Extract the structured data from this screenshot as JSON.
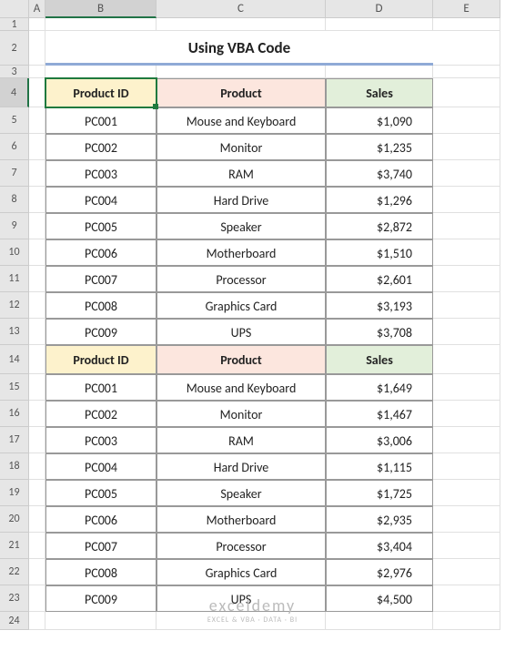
{
  "columns": [
    "",
    "A",
    "B",
    "C",
    "D",
    "E"
  ],
  "title": "Using VBA Code",
  "headers": {
    "b": "Product ID",
    "c": "Product",
    "d": "Sales"
  },
  "rows1": [
    {
      "id": "PC001",
      "product": "Mouse and Keyboard",
      "sales": "$1,090"
    },
    {
      "id": "PC002",
      "product": "Monitor",
      "sales": "$1,235"
    },
    {
      "id": "PC003",
      "product": "RAM",
      "sales": "$3,740"
    },
    {
      "id": "PC004",
      "product": "Hard Drive",
      "sales": "$1,296"
    },
    {
      "id": "PC005",
      "product": "Speaker",
      "sales": "$2,872"
    },
    {
      "id": "PC006",
      "product": "Motherboard",
      "sales": "$1,510"
    },
    {
      "id": "PC007",
      "product": "Processor",
      "sales": "$2,601"
    },
    {
      "id": "PC008",
      "product": "Graphics Card",
      "sales": "$3,193"
    },
    {
      "id": "PC009",
      "product": "UPS",
      "sales": "$3,708"
    }
  ],
  "rows2": [
    {
      "id": "PC001",
      "product": "Mouse and Keyboard",
      "sales": "$1,649"
    },
    {
      "id": "PC002",
      "product": "Monitor",
      "sales": "$1,467"
    },
    {
      "id": "PC003",
      "product": "RAM",
      "sales": "$3,006"
    },
    {
      "id": "PC004",
      "product": "Hard Drive",
      "sales": "$1,115"
    },
    {
      "id": "PC005",
      "product": "Speaker",
      "sales": "$1,725"
    },
    {
      "id": "PC006",
      "product": "Motherboard",
      "sales": "$2,935"
    },
    {
      "id": "PC007",
      "product": "Processor",
      "sales": "$3,404"
    },
    {
      "id": "PC008",
      "product": "Graphics Card",
      "sales": "$2,976"
    },
    {
      "id": "PC009",
      "product": "UPS",
      "sales": "$4,500"
    }
  ],
  "watermark": {
    "line1": "exceldemy",
    "line2": "EXCEL & VBA · DATA · BI"
  }
}
